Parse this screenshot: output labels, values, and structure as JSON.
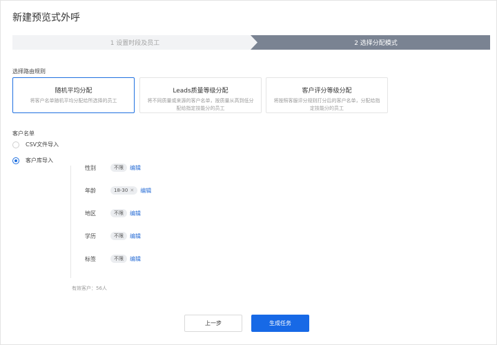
{
  "page": {
    "title": "新建预览式外呼"
  },
  "steps": [
    {
      "label": "1 设置时段及员工",
      "active": false
    },
    {
      "label": "2 选择分配模式",
      "active": true
    }
  ],
  "routing": {
    "label": "选择路由规则",
    "options": [
      {
        "title": "随机平均分配",
        "desc": "将客户名单随机平均分配给所选择的员工",
        "selected": true
      },
      {
        "title": "Leads质量等级分配",
        "desc": "将不同质量或来源的客户名单，按质量从高到低分配给指定技能分的员工",
        "selected": false
      },
      {
        "title": "客户评分等级分配",
        "desc": "将按照客服评分规则打分后的客户名单，分配给指定技能分的员工",
        "selected": false
      }
    ]
  },
  "customer_list": {
    "label": "客户名单",
    "sources": [
      {
        "label": "CSV文件导入",
        "checked": false
      },
      {
        "label": "客户库导入",
        "checked": true
      }
    ],
    "filters": [
      {
        "key": "性别",
        "value": "不限",
        "removable": false,
        "edit": "编辑"
      },
      {
        "key": "年龄",
        "value": "18-30",
        "removable": true,
        "edit": "编辑"
      },
      {
        "key": "地区",
        "value": "不限",
        "removable": false,
        "edit": "编辑"
      },
      {
        "key": "学历",
        "value": "不限",
        "removable": false,
        "edit": "编辑"
      },
      {
        "key": "标签",
        "value": "不限",
        "removable": false,
        "edit": "编辑"
      }
    ],
    "valid_count_text": "有效客户：56人"
  },
  "actions": {
    "prev": "上一步",
    "generate": "生成任务"
  },
  "colors": {
    "accent": "#1769e6",
    "step_active": "#7a8392"
  }
}
